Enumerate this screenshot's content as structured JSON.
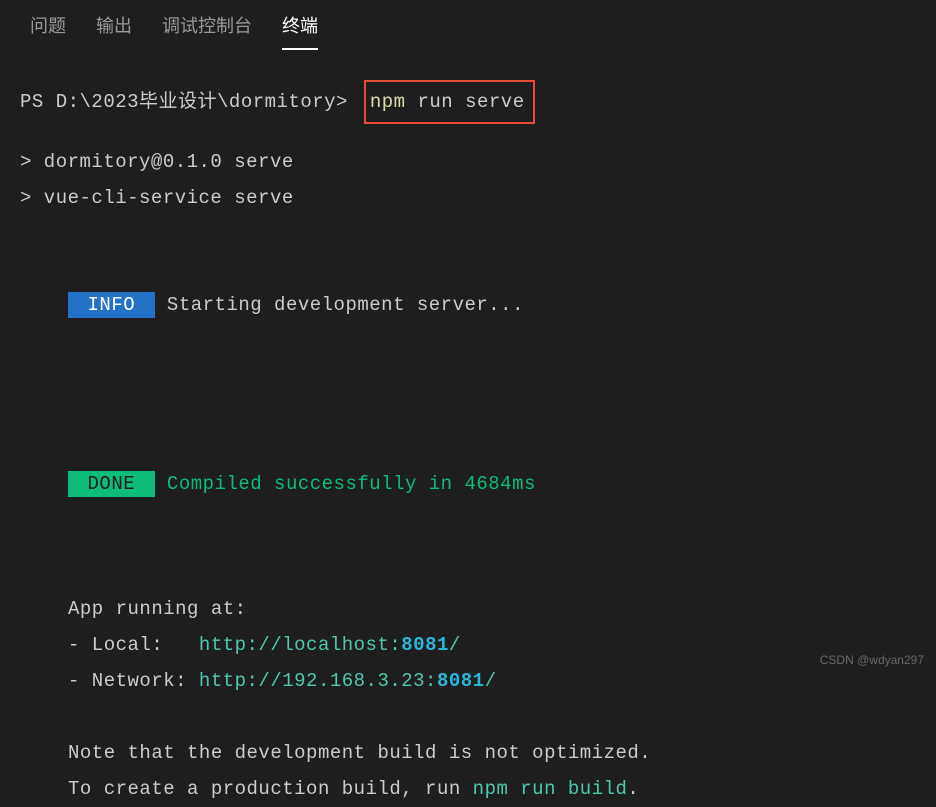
{
  "tabs": {
    "problems": "问题",
    "output": "输出",
    "debug_console": "调试控制台",
    "terminal": "终端"
  },
  "terminal": {
    "prompt": "PS D:\\2023毕业设计\\dormitory>",
    "command": "npm",
    "command_args": "run serve",
    "script_line1": "> dormitory@0.1.0 serve",
    "script_line2": "> vue-cli-service serve",
    "info_badge": " INFO ",
    "info_text": " Starting development server...",
    "done_badge": " DONE ",
    "done_text": " Compiled successfully in 4684ms",
    "app_running": "App running at:",
    "local_label": "- Local:   ",
    "local_url": "http://localhost:",
    "local_port": "8081",
    "local_slash": "/",
    "network_label": "- Network: ",
    "network_url": "http://192.168.3.23:",
    "network_port": "8081",
    "network_slash": "/",
    "note_line1": "Note that the development build is not optimized.",
    "note_line2_pre": "To create a production build, run ",
    "note_line2_cmd": "npm run build",
    "note_line2_post": "."
  },
  "watermark": "CSDN @wdyan297"
}
